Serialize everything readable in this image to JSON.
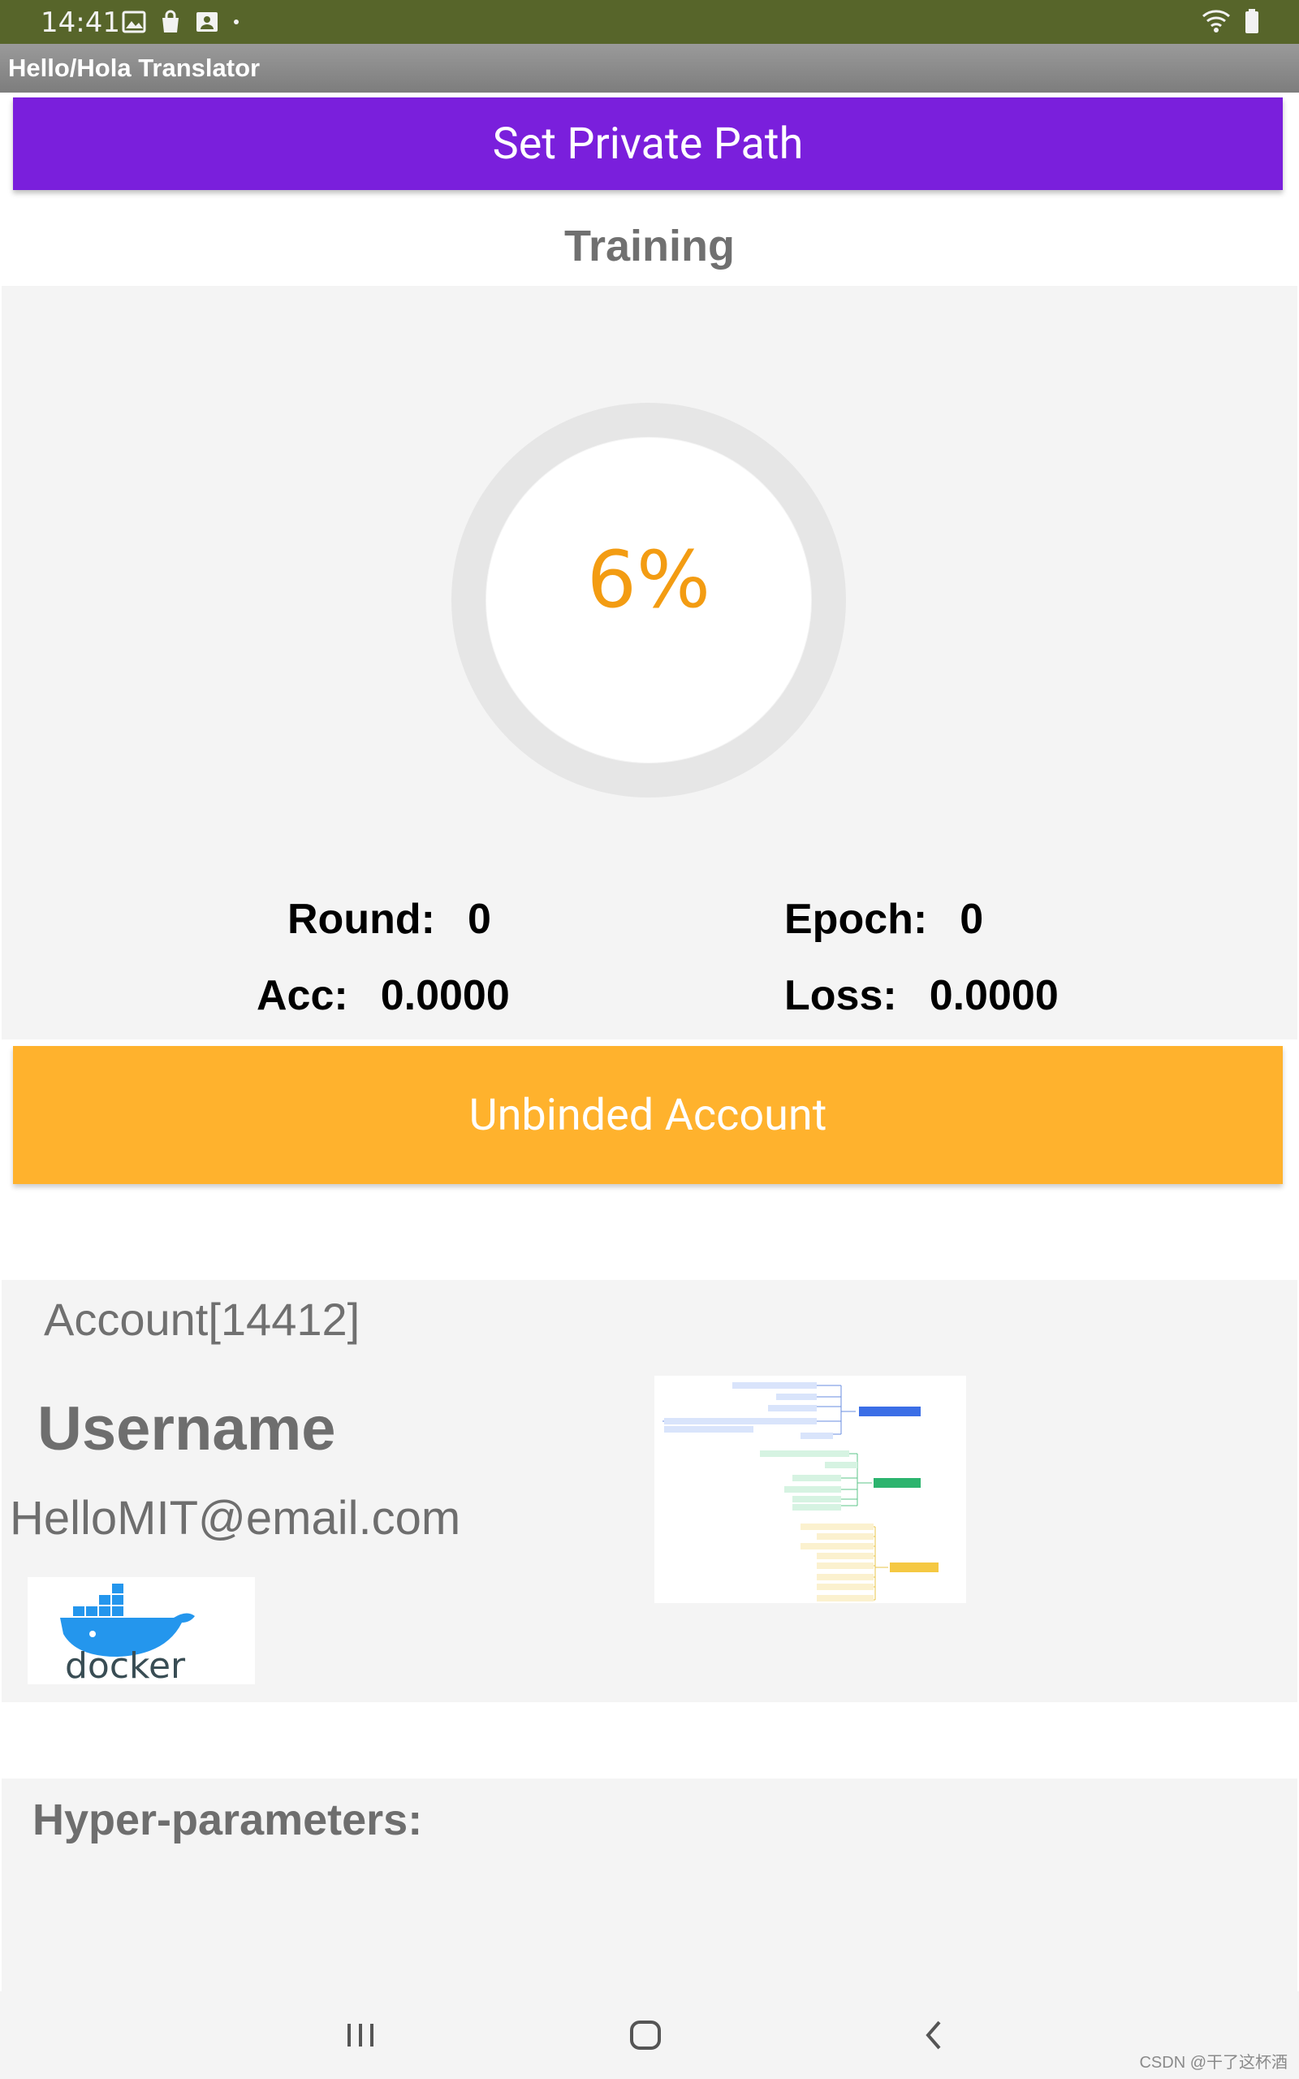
{
  "status_bar": {
    "time": "14:41",
    "icons": [
      "image-icon",
      "shopping-bag-icon",
      "contact-card-icon",
      "dot-icon"
    ],
    "right_icons": [
      "wifi-icon",
      "battery-icon"
    ]
  },
  "app": {
    "title": "Hello/Hola Translator"
  },
  "buttons": {
    "set_private_path": "Set Private Path",
    "unbind_account": "Unbinded Account"
  },
  "training": {
    "section_title": "Training",
    "progress_label": "6%",
    "progress_fraction": 0.06,
    "stats": {
      "round_label": "Round:",
      "round_value": "0",
      "epoch_label": "Epoch:",
      "epoch_value": "0",
      "acc_label": "Acc:",
      "acc_value": "0.0000",
      "loss_label": "Loss:",
      "loss_value": "0.0000"
    }
  },
  "account": {
    "title": "Account[14412]",
    "username": "Username",
    "email": "HelloMIT@email.com",
    "logo_text": "docker"
  },
  "hyper_parameters": {
    "title": "Hyper-parameters:"
  },
  "nav": {
    "icons": [
      "recents-icon",
      "home-icon",
      "back-icon"
    ]
  },
  "watermark": "CSDN @干了这杯酒",
  "colors": {
    "status_bar": "#57652a",
    "primary_button": "#7a1fdc",
    "unbind_button": "#ffb22d",
    "progress_text": "#f39c12",
    "ring_track": "#e6e6e6"
  }
}
